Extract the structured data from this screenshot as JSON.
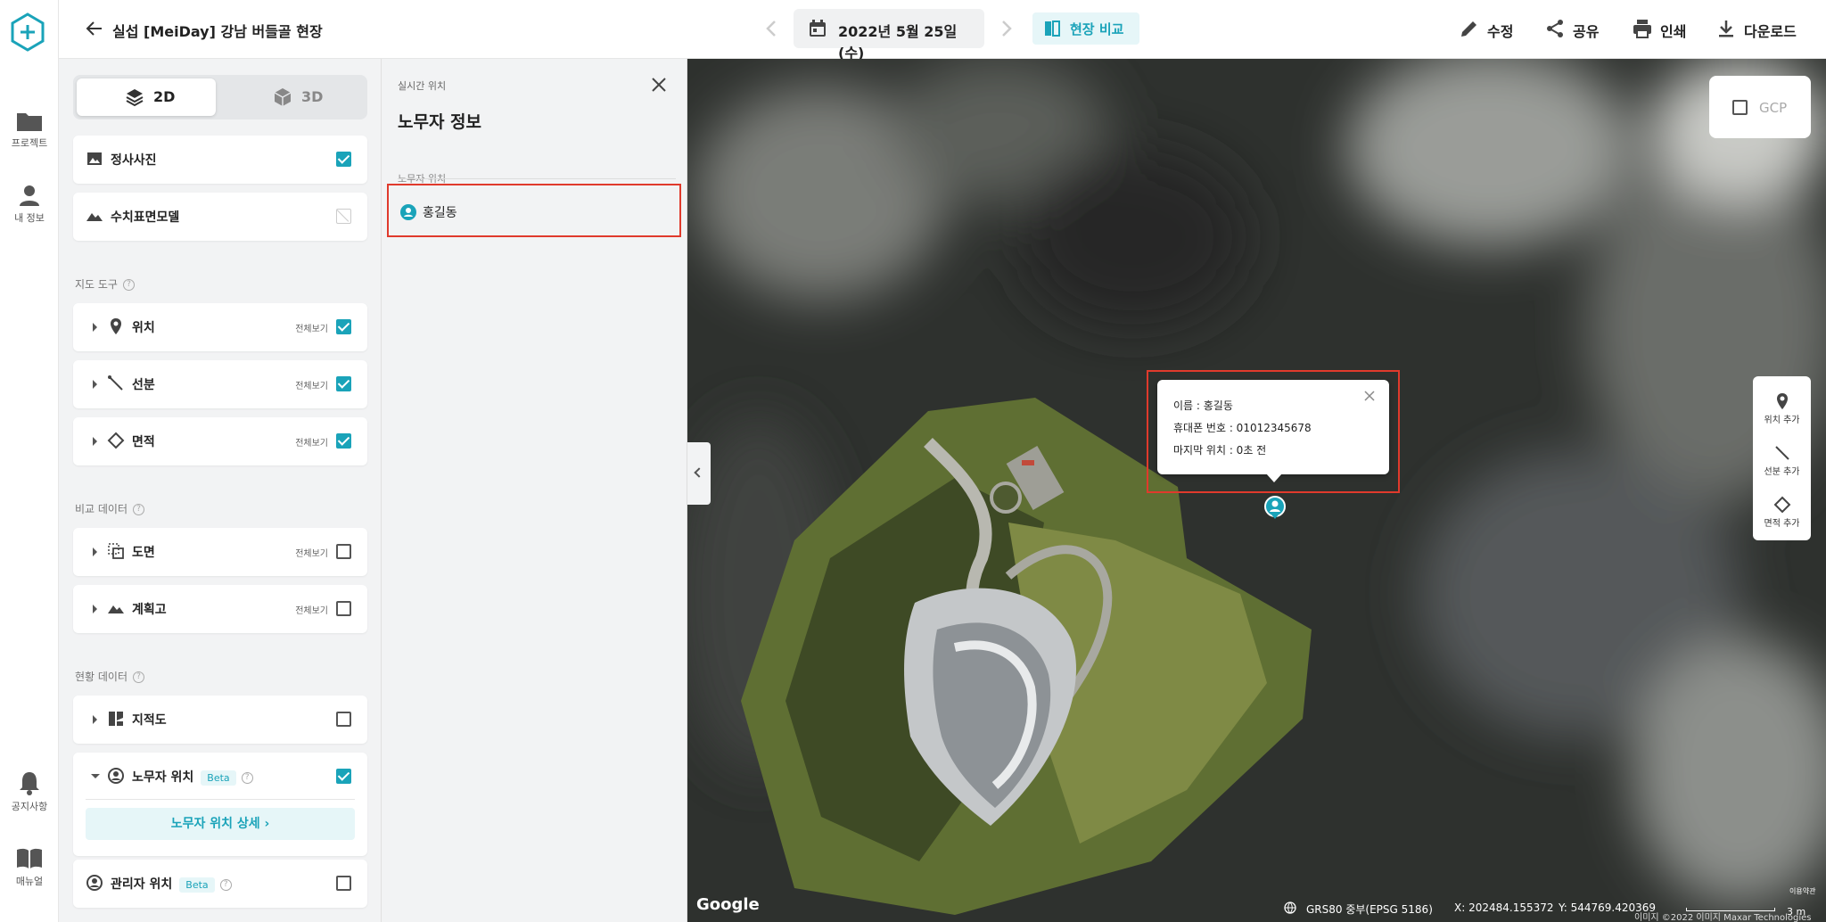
{
  "rail": {
    "items": [
      {
        "label": "프로젝트",
        "icon": "folder-icon"
      },
      {
        "label": "내 정보",
        "icon": "person-icon"
      },
      {
        "label": "공지사항",
        "icon": "bell-icon"
      },
      {
        "label": "매뉴얼",
        "icon": "book-icon"
      }
    ]
  },
  "header": {
    "project_title": "실섭 [MeiDay] 강남 버들골 현장",
    "date": "2022년 5월 25일 (수)",
    "compare_label": "현장 비교",
    "actions": [
      "수정",
      "공유",
      "인쇄",
      "다운로드"
    ]
  },
  "layers": {
    "view_toggle": [
      "2D",
      "3D"
    ],
    "base_layers": [
      {
        "label": "정사사진",
        "checked": true
      },
      {
        "label": "수치표면모델",
        "checked": false,
        "disabled": true
      }
    ],
    "map_tools_title": "지도 도구",
    "map_tools": [
      {
        "label": "위치",
        "show_all": "전체보기",
        "checked": true
      },
      {
        "label": "선분",
        "show_all": "전체보기",
        "checked": true
      },
      {
        "label": "면적",
        "show_all": "전체보기",
        "checked": true
      }
    ],
    "compare_title": "비교 데이터",
    "compare": [
      {
        "label": "도면",
        "show_all": "전체보기",
        "checked": false
      },
      {
        "label": "계획고",
        "show_all": "전체보기",
        "checked": false
      }
    ],
    "status_title": "현황 데이터",
    "status_items": [
      {
        "label": "지적도",
        "checked": false
      }
    ],
    "worker": {
      "label": "노무자 위치",
      "badge": "Beta",
      "checked": true,
      "detail_button": "노무자 위치 상세"
    },
    "manager": {
      "label": "관리자 위치",
      "badge": "Beta",
      "checked": false
    }
  },
  "info_panel": {
    "subtitle": "실시간 위치",
    "title": "노무자 정보",
    "list_header": "노무자 위치",
    "workers": [
      {
        "name": "홍길동"
      }
    ]
  },
  "map": {
    "gcp_label": "GCP",
    "tools": [
      "위치 추가",
      "선분 추가",
      "면적 추가"
    ],
    "popup": {
      "name": "이름 : 홍길동",
      "phone": "휴대폰 번호 : 01012345678",
      "last_seen": "마지막 위치 : 0초 전"
    },
    "google_label": "Google",
    "crs": "GRS80 중부(EPSG 5186)",
    "x_coord": "X: 202484.155372",
    "y_coord": "Y: 544769.420369",
    "terms": "이용약관",
    "imagery": "이미지 ©2022 이미지 Maxar Technologies",
    "scale": "3 m"
  },
  "colors": {
    "accent": "#1aa3b9",
    "highlight": "#e03a2c"
  }
}
